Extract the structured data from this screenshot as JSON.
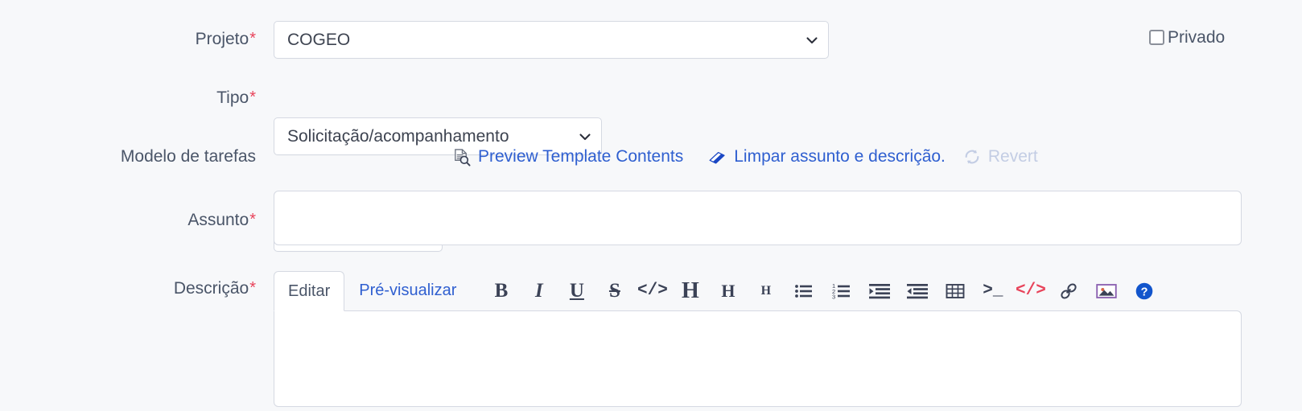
{
  "colors": {
    "page_bg": "#f7f8fa",
    "label_text": "#4a5568",
    "required_asterisk": "#e8435a",
    "link_blue": "#2f5fd0",
    "disabled_blue": "#c3cde4",
    "field_border": "#d5d9e2",
    "field_bg": "#ffffff",
    "toolbar_icon": "#3b4256",
    "code_red": "#e8435a",
    "help_blue": "#1255cc"
  },
  "fields": {
    "projeto": {
      "label": "Projeto",
      "required": true,
      "value": "COGEO",
      "icon": "chevron-down-icon"
    },
    "tipo": {
      "label": "Tipo",
      "required": true,
      "value": "Solicitação/acompanhamento",
      "icon": "chevron-down-icon"
    },
    "modelo_de_tarefas": {
      "label": "Modelo de tarefas",
      "required": false,
      "value": "---",
      "icon": "chevron-down-icon"
    },
    "assunto": {
      "label": "Assunto",
      "required": true,
      "value": "",
      "placeholder": ""
    },
    "descricao": {
      "label": "Descrição",
      "required": true,
      "value": "",
      "placeholder": ""
    }
  },
  "privado": {
    "label": "Privado",
    "checked": false
  },
  "template_actions": {
    "preview": {
      "label": "Preview Template Contents",
      "icon": "document-search-icon",
      "enabled": true
    },
    "clear": {
      "label": "Limpar assunto e descrição.",
      "icon": "eraser-icon",
      "enabled": true
    },
    "revert": {
      "label": "Revert",
      "icon": "refresh-icon",
      "enabled": false
    }
  },
  "editor": {
    "tabs": [
      {
        "label": "Editar",
        "active": true
      },
      {
        "label": "Pré-visualizar",
        "active": false
      }
    ],
    "toolbar": [
      {
        "name": "bold-icon",
        "glyph": "B"
      },
      {
        "name": "italic-icon",
        "glyph": "I"
      },
      {
        "name": "underline-icon",
        "glyph": "U"
      },
      {
        "name": "strikethrough-icon",
        "glyph": "S"
      },
      {
        "name": "inline-code-icon",
        "glyph": "</>"
      },
      {
        "name": "heading-1-icon",
        "glyph": "H"
      },
      {
        "name": "heading-2-icon",
        "glyph": "H"
      },
      {
        "name": "heading-3-icon",
        "glyph": "H"
      },
      {
        "name": "unordered-list-icon",
        "glyph": ""
      },
      {
        "name": "ordered-list-icon",
        "glyph": ""
      },
      {
        "name": "indent-increase-icon",
        "glyph": ""
      },
      {
        "name": "indent-decrease-icon",
        "glyph": ""
      },
      {
        "name": "table-icon",
        "glyph": ""
      },
      {
        "name": "terminal-icon",
        "glyph": ">_"
      },
      {
        "name": "code-block-icon",
        "glyph": "</>"
      },
      {
        "name": "link-icon",
        "glyph": ""
      },
      {
        "name": "image-icon",
        "glyph": ""
      },
      {
        "name": "help-icon",
        "glyph": "?"
      }
    ]
  }
}
